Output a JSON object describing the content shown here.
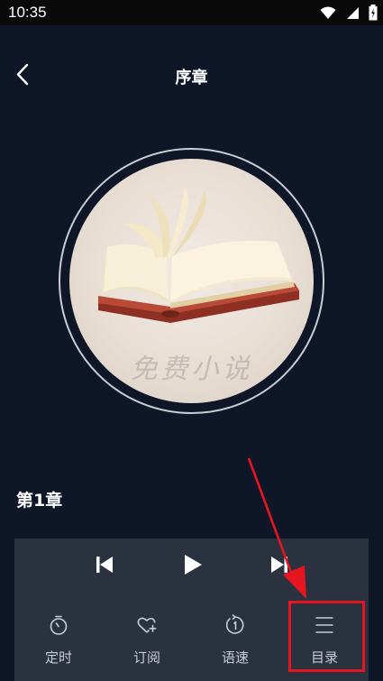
{
  "status": {
    "time": "10:35"
  },
  "header": {
    "title": "序章"
  },
  "cover": {
    "text": "免费小说"
  },
  "chapter": {
    "title": "第1章"
  },
  "tabs": [
    {
      "label": "定时",
      "icon": "timer-icon"
    },
    {
      "label": "订阅",
      "icon": "heart-plus-icon"
    },
    {
      "label": "语速",
      "icon": "speed-icon"
    },
    {
      "label": "目录",
      "icon": "menu-list-icon"
    }
  ],
  "colors": {
    "background": "#0f1628",
    "panel": "#2a3240",
    "highlight": "#e5161f"
  }
}
